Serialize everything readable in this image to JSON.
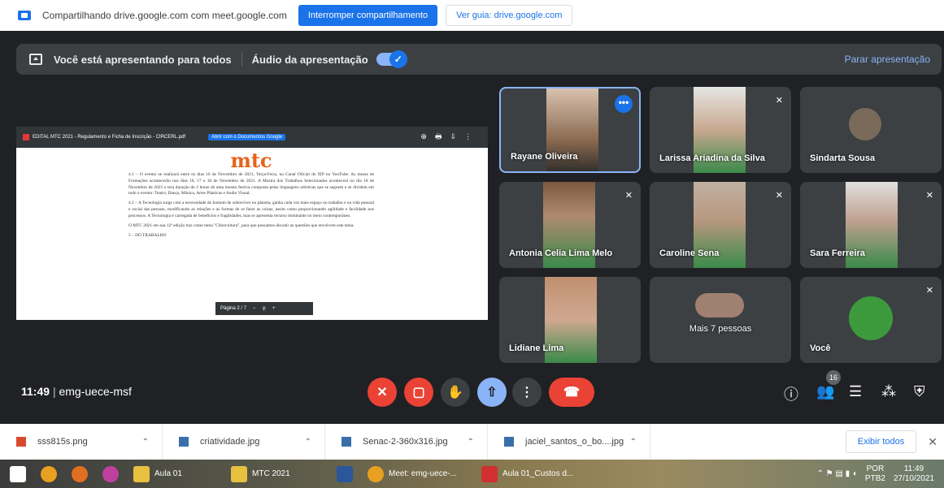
{
  "sharebar": {
    "text": "Compartilhando drive.google.com com meet.google.com",
    "stop_label": "Interromper compartilhamento",
    "guide_label": "Ver guia: drive.google.com"
  },
  "banner": {
    "presenting": "Você está apresentando para todos",
    "audio": "Áudio da apresentação",
    "stop": "Parar apresentação"
  },
  "presentation": {
    "file_name": "EDITAL MTC 2021 - Regulamento e Ficha de Inscrição - CIRCERL.pdf",
    "open_with": "Abrir com o Documentos Google",
    "logo": "mtc",
    "para1": "4.1 – O evento se realizará entre os dias 16 de Novembro de 2021, Terça-Feira, no Canal Oficial do IEP no YouTube. As mesas de Formações acontecerão nos dias 16, 17 e 18 de Novembro de 2021. A Mostra dos Trabalhos Selecionados acontecerá no dia 18 de Novembro de 2021 e terá duração de 2 horas de uma mostra festiva composta pelas linguagens artísticas que se seguem e se dividem em todo o evento: Teatro, Dança, Música, Artes Plásticas e Audio Visual.",
    "para2": "4.2 – A Tecnologia surge com a necessidade do homem de sobreviver no planeta, ganha cada vez mais espaço no trabalho e na vida pessoal e social das pessoas, modificando as relações e as formas de se fazer as coisas, assim como proporcionando agilidade e facilidade nos processos. A Tecnologia é carregada de benefícios e fragilidades, mas se apresenta recurso dominante no meio contemporâneo.",
    "para3": "O MTC 2021 em sua 12ª edição traz como tema \"Cibercultura\", para que possamos discutir as questões que envolvem este tema.",
    "section": "5 – DO TRABALHO",
    "pager": "Página  2  /  7",
    "zoom_minus": "−",
    "zoom_plus": "+"
  },
  "tiles": [
    {
      "name": "Rayane Oliveira"
    },
    {
      "name": "Larissa Ariadina da Silva"
    },
    {
      "name": "Sindarta Sousa"
    },
    {
      "name": "Antonia Celia Lima Melo"
    },
    {
      "name": "Caroline Sena"
    },
    {
      "name": "Sara Ferreira"
    },
    {
      "name": "Lidiane Lima"
    },
    {
      "name": "Mais 7 pessoas"
    },
    {
      "name": "Você"
    }
  ],
  "meeting": {
    "time": "11:49",
    "code": "emg-uece-msf",
    "people_count": "16"
  },
  "downloads": [
    {
      "name": "sss815s.png"
    },
    {
      "name": "criatividade.jpg"
    },
    {
      "name": "Senac-2-360x316.jpg"
    },
    {
      "name": "jaciel_santos_o_bo....jpg"
    }
  ],
  "shelf": {
    "show_all": "Exibir todos"
  },
  "taskbar": {
    "items": [
      "Aula 01",
      "MTC 2021",
      "Meet: emg-uece-...",
      "Aula 01_Custos d..."
    ],
    "lang": "POR",
    "lang2": "PTB2",
    "clock_time": "11:49",
    "clock_date": "27/10/2021"
  },
  "colors": {
    "accent": "#1a73e8",
    "end_call": "#ea4335",
    "bg": "#202124",
    "tile": "#3c4043"
  }
}
